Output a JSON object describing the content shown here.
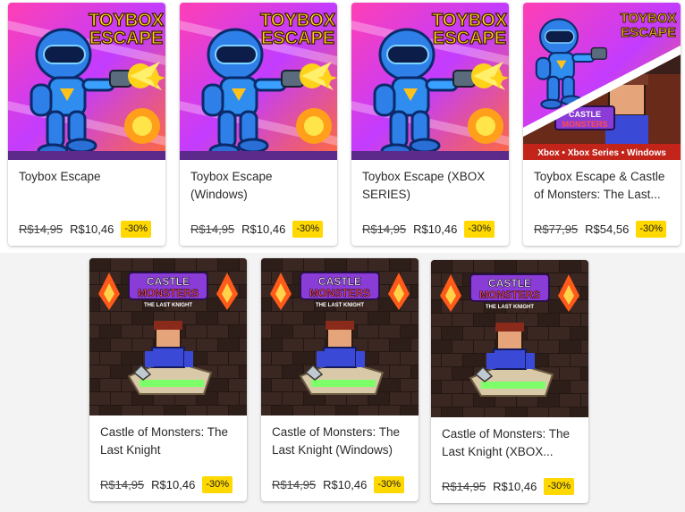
{
  "colors": {
    "badge": "#ffd800",
    "card_bg": "#ffffff",
    "page_bg": "#f3f3f3"
  },
  "logos": {
    "toybox": [
      "TOYBOX",
      "ESCAPE"
    ],
    "castle": [
      "CASTLE",
      "MONSTERS",
      "THE LAST KNIGHT"
    ],
    "bundle_platforms": "Xbox • Xbox Series • Windows"
  },
  "products": [
    {
      "title": "Toybox Escape",
      "old_price": "R$14,95",
      "new_price": "R$10,46",
      "discount": "-30%",
      "art": "toybox"
    },
    {
      "title": "Toybox Escape (Windows)",
      "old_price": "R$14,95",
      "new_price": "R$10,46",
      "discount": "-30%",
      "art": "toybox"
    },
    {
      "title": "Toybox Escape (XBOX SERIES)",
      "old_price": "R$14,95",
      "new_price": "R$10,46",
      "discount": "-30%",
      "art": "toybox"
    },
    {
      "title": "Toybox Escape & Castle of Monsters: The Last...",
      "old_price": "R$77,95",
      "new_price": "R$54,56",
      "discount": "-30%",
      "art": "bundle"
    },
    {
      "title": "Castle of Monsters: The Last Knight",
      "old_price": "R$14,95",
      "new_price": "R$10,46",
      "discount": "-30%",
      "art": "castle"
    },
    {
      "title": "Castle of Monsters: The Last Knight (Windows)",
      "old_price": "R$14,95",
      "new_price": "R$10,46",
      "discount": "-30%",
      "art": "castle"
    },
    {
      "title": "Castle of Monsters: The Last Knight (XBOX...",
      "old_price": "R$14,95",
      "new_price": "R$10,46",
      "discount": "-30%",
      "art": "castle"
    }
  ]
}
